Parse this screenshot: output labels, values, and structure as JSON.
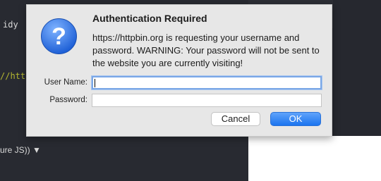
{
  "background": {
    "line1": "idy",
    "line2": "//http",
    "line3": "ure JS)) ▼"
  },
  "dialog": {
    "icon": "question-icon",
    "title": "Authentication Required",
    "message": "https://httpbin.org is requesting your username and password. WARNING: Your password will not be sent to the website you are currently visiting!",
    "username_label": "User Name:",
    "username_value": "",
    "password_label": "Password:",
    "password_value": "",
    "cancel_label": "Cancel",
    "ok_label": "OK"
  },
  "colors": {
    "accent": "#1b74ef",
    "focus_ring": "#7aa7e6",
    "icon_blue": "#2d6fe0"
  }
}
